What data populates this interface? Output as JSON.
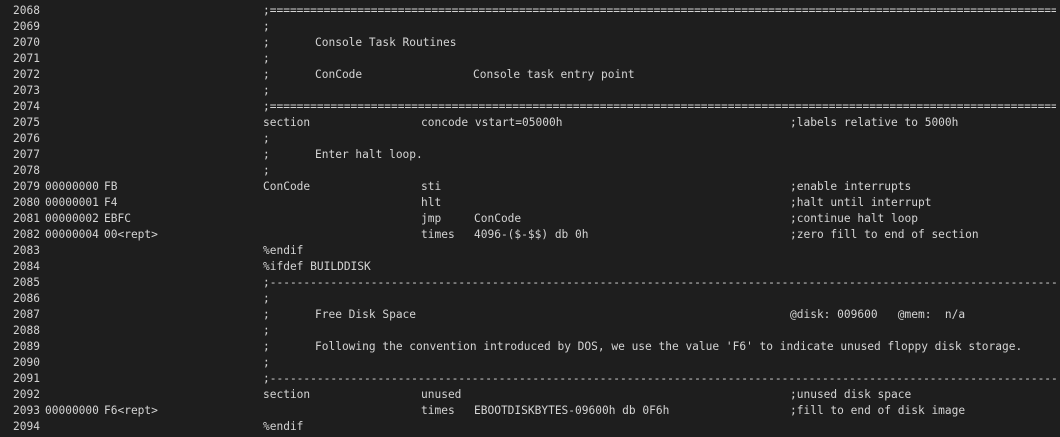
{
  "listing": {
    "rows": [
      {
        "line": "2068",
        "rule": ";=============================================================================================================================================="
      },
      {
        "line": "2069",
        "label": ";"
      },
      {
        "line": "2070",
        "label": ";",
        "indent": "Console Task Routines"
      },
      {
        "line": "2071",
        "label": ";"
      },
      {
        "line": "2072",
        "label": ";",
        "indent": "ConCode",
        "wide": "Console task entry point"
      },
      {
        "line": "2073",
        "label": ";"
      },
      {
        "line": "2074",
        "rule": ";=============================================================================================================================================="
      },
      {
        "line": "2075",
        "label": "section",
        "op": "concode vstart=05000h",
        "cmt": ";labels relative to 5000h"
      },
      {
        "line": "2076",
        "label": ";"
      },
      {
        "line": "2077",
        "label": ";",
        "indent": "Enter halt loop."
      },
      {
        "line": "2078",
        "label": ";"
      },
      {
        "line": "2079",
        "addr": "00000000",
        "bytes": "FB",
        "label": "ConCode",
        "op": "sti",
        "cmt": ";enable interrupts"
      },
      {
        "line": "2080",
        "addr": "00000001",
        "bytes": "F4",
        "op": "hlt",
        "cmt": ";halt until interrupt"
      },
      {
        "line": "2081",
        "addr": "00000002",
        "bytes": "EBFC",
        "op": "jmp",
        "arg": "ConCode",
        "cmt": ";continue halt loop"
      },
      {
        "line": "2082",
        "addr": "00000004",
        "bytes": "00<rept>",
        "op": "times",
        "arg": "4096-($-$$) db 0h",
        "cmt": ";zero fill to end of section"
      },
      {
        "line": "2083",
        "label": "%endif"
      },
      {
        "line": "2084",
        "label": "%ifdef BUILDDISK"
      },
      {
        "line": "2085",
        "rule": ";----------------------------------------------------------------------------------------------------------------------------------------------"
      },
      {
        "line": "2086",
        "label": ";"
      },
      {
        "line": "2087",
        "label": ";",
        "indent": "Free Disk Space",
        "disk": "@disk: 009600   @mem:  n/a"
      },
      {
        "line": "2088",
        "label": ";"
      },
      {
        "line": "2089",
        "label": ";",
        "indent": "Following the convention introduced by DOS, we use the value 'F6' to indicate unused floppy disk storage."
      },
      {
        "line": "2090",
        "label": ";"
      },
      {
        "line": "2091",
        "rule": ";----------------------------------------------------------------------------------------------------------------------------------------------"
      },
      {
        "line": "2092",
        "label": "section",
        "op": "unused",
        "cmt": ";unused disk space"
      },
      {
        "line": "2093",
        "addr": "00000000",
        "bytes": "F6<rept>",
        "op": "times",
        "arg": "EBOOTDISKBYTES-09600h db 0F6h",
        "cmt": ";fill to end of disk image"
      },
      {
        "line": "2094",
        "label": "%endif"
      }
    ]
  }
}
